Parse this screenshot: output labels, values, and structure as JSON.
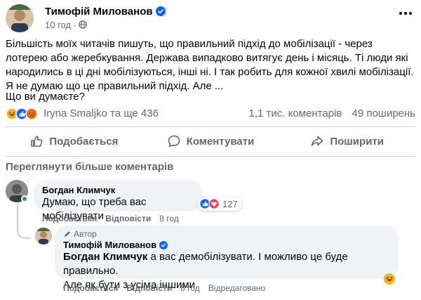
{
  "post": {
    "author": "Тимофій Милованов",
    "time": "10 год",
    "text": "Більшість моїх читачів пишуть, що правильний підхід до мобілізації - через лотерею або жеребкування. Держава випадково витягує день і місяць. Ті люди які народились в ці дні мобілізуються, інші ні. І так робить для кожної хвилі мобілізації. Я не думаю що це правильний підхід. Але ...",
    "question": "Що ви думаєте?",
    "reactors": "Iryna Smaljko та ще 436",
    "comments_count": "1,1 тис. коментарів",
    "shares_count": "49 поширень"
  },
  "actions": {
    "like": "Подобається",
    "comment": "Коментувати",
    "share": "Поширити"
  },
  "more_comments": "Переглянути більше коментарів",
  "comments": [
    {
      "name": "Богдан Климчук",
      "text": "Думаю, що треба вас мобілізувати",
      "like": "Подобається",
      "reply": "Відповісти",
      "time": "8 год",
      "reactions_count": "127"
    }
  ],
  "reply": {
    "author_tag": "Автор",
    "name": "Тимофій Милованов",
    "mention": "Богдан Климчук",
    "text_line1": " а вас демобілізувати. І можливо це буде правильно.",
    "text_line2": "Але як бути з усіма іншими.",
    "like": "Подобається",
    "reply": "Відповісти",
    "time": "8 год",
    "edited": "Відредаговано"
  },
  "colors": {
    "like_blue": "#0866ff",
    "love_red": "#f33e58",
    "haha_yellow": "#f7b125",
    "angry_orange": "#e9710f",
    "muted_text": "#65676b",
    "bubble_bg": "#f0f2f5"
  },
  "icons": [
    "verified-icon",
    "globe-icon",
    "more-icon",
    "like-icon",
    "comment-icon",
    "share-icon",
    "pen-icon",
    "emoji-icon"
  ]
}
